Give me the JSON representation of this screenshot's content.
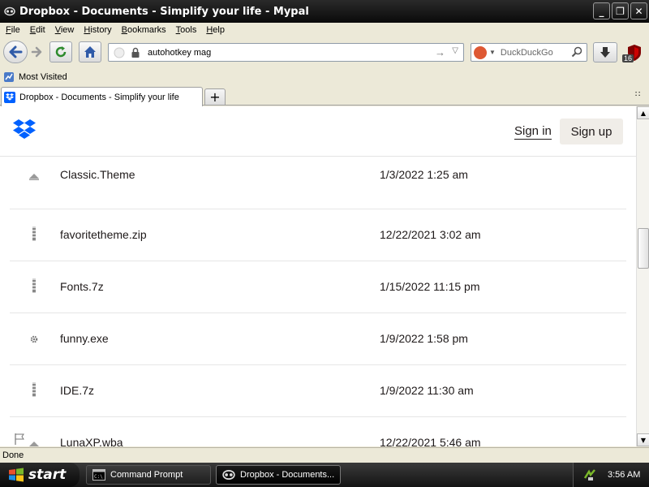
{
  "window": {
    "title": "Dropbox - Documents - Simplify your life - Mypal",
    "controls": {
      "minimize": "_",
      "maximize": "❐",
      "close": "✕"
    }
  },
  "menubar": [
    {
      "label": "File",
      "ul": "F",
      "rest": "ile"
    },
    {
      "label": "Edit",
      "ul": "E",
      "rest": "dit"
    },
    {
      "label": "View",
      "ul": "V",
      "rest": "iew"
    },
    {
      "label": "History",
      "ul": "H",
      "rest": "istory"
    },
    {
      "label": "Bookmarks",
      "ul": "B",
      "rest": "ookmarks"
    },
    {
      "label": "Tools",
      "ul": "T",
      "rest": "ools"
    },
    {
      "label": "Help",
      "ul": "H",
      "rest": "elp"
    }
  ],
  "navbar": {
    "url": "autohotkey mag",
    "search_placeholder": "DuckDuckGo",
    "addon_badge": "16"
  },
  "bookmarks": {
    "most_visited": "Most Visited"
  },
  "tabs": {
    "active_label": "Dropbox - Documents - Simplify your life",
    "new_tab": "+",
    "list": "∷"
  },
  "site": {
    "sign_in": "Sign in",
    "sign_up": "Sign up"
  },
  "files": [
    {
      "name": "Classic.Theme",
      "date": "1/3/2022 1:25 am",
      "icon": "theme-icon"
    },
    {
      "name": "favoritetheme.zip",
      "date": "12/22/2021 3:02 am",
      "icon": "archive-icon"
    },
    {
      "name": "Fonts.7z",
      "date": "1/15/2022 11:15 pm",
      "icon": "archive-icon"
    },
    {
      "name": "funny.exe",
      "date": "1/9/2022 1:58 pm",
      "icon": "gear-icon"
    },
    {
      "name": "IDE.7z",
      "date": "1/9/2022 11:30 am",
      "icon": "archive-icon"
    },
    {
      "name": "LunaXP.wba",
      "date": "12/22/2021 5:46 am",
      "icon": "theme-icon"
    }
  ],
  "status": {
    "text": "Done"
  },
  "taskbar": {
    "start": "start",
    "tasks": [
      {
        "label": "Command Prompt"
      },
      {
        "label": "Dropbox - Documents..."
      }
    ],
    "clock": "3:56 AM"
  },
  "colors": {
    "dropbox_blue": "#0061ff",
    "titlebar": "#111111",
    "chrome": "#ece9d8"
  }
}
